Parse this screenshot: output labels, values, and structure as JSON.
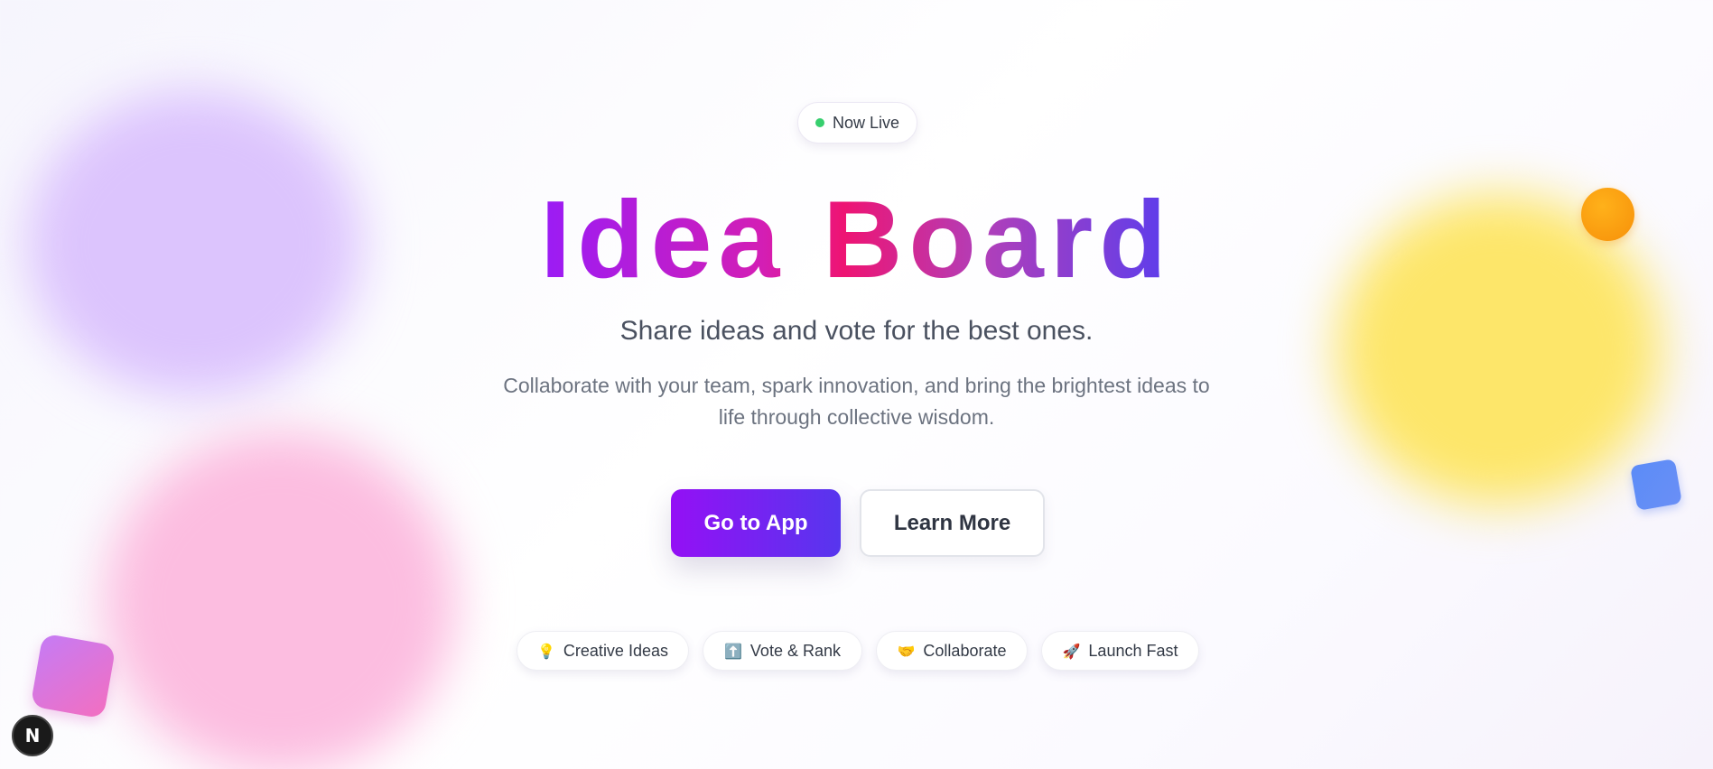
{
  "badge": {
    "label": "Now Live",
    "status_color": "#37cf6e"
  },
  "hero": {
    "title": "Idea Board",
    "subtitle": "Share ideas and vote for the best ones.",
    "description": "Collaborate with your team, spark innovation, and bring the brightest ideas to life through collective wisdom."
  },
  "actions": {
    "primary_label": "Go to App",
    "secondary_label": "Learn More"
  },
  "features": [
    {
      "icon": "lightbulb-icon",
      "glyph": "💡",
      "label": "Creative Ideas"
    },
    {
      "icon": "up-arrow-icon",
      "glyph": "⬆️",
      "label": "Vote & Rank"
    },
    {
      "icon": "handshake-icon",
      "glyph": "🤝",
      "label": "Collaborate"
    },
    {
      "icon": "rocket-icon",
      "glyph": "🚀",
      "label": "Launch Fast"
    }
  ],
  "dev_badge": {
    "glyph": "N",
    "icon": "nextjs-icon"
  },
  "colors": {
    "brand_start": "#9410f5",
    "brand_end": "#5736ee",
    "title_pink": "#ee1473"
  }
}
